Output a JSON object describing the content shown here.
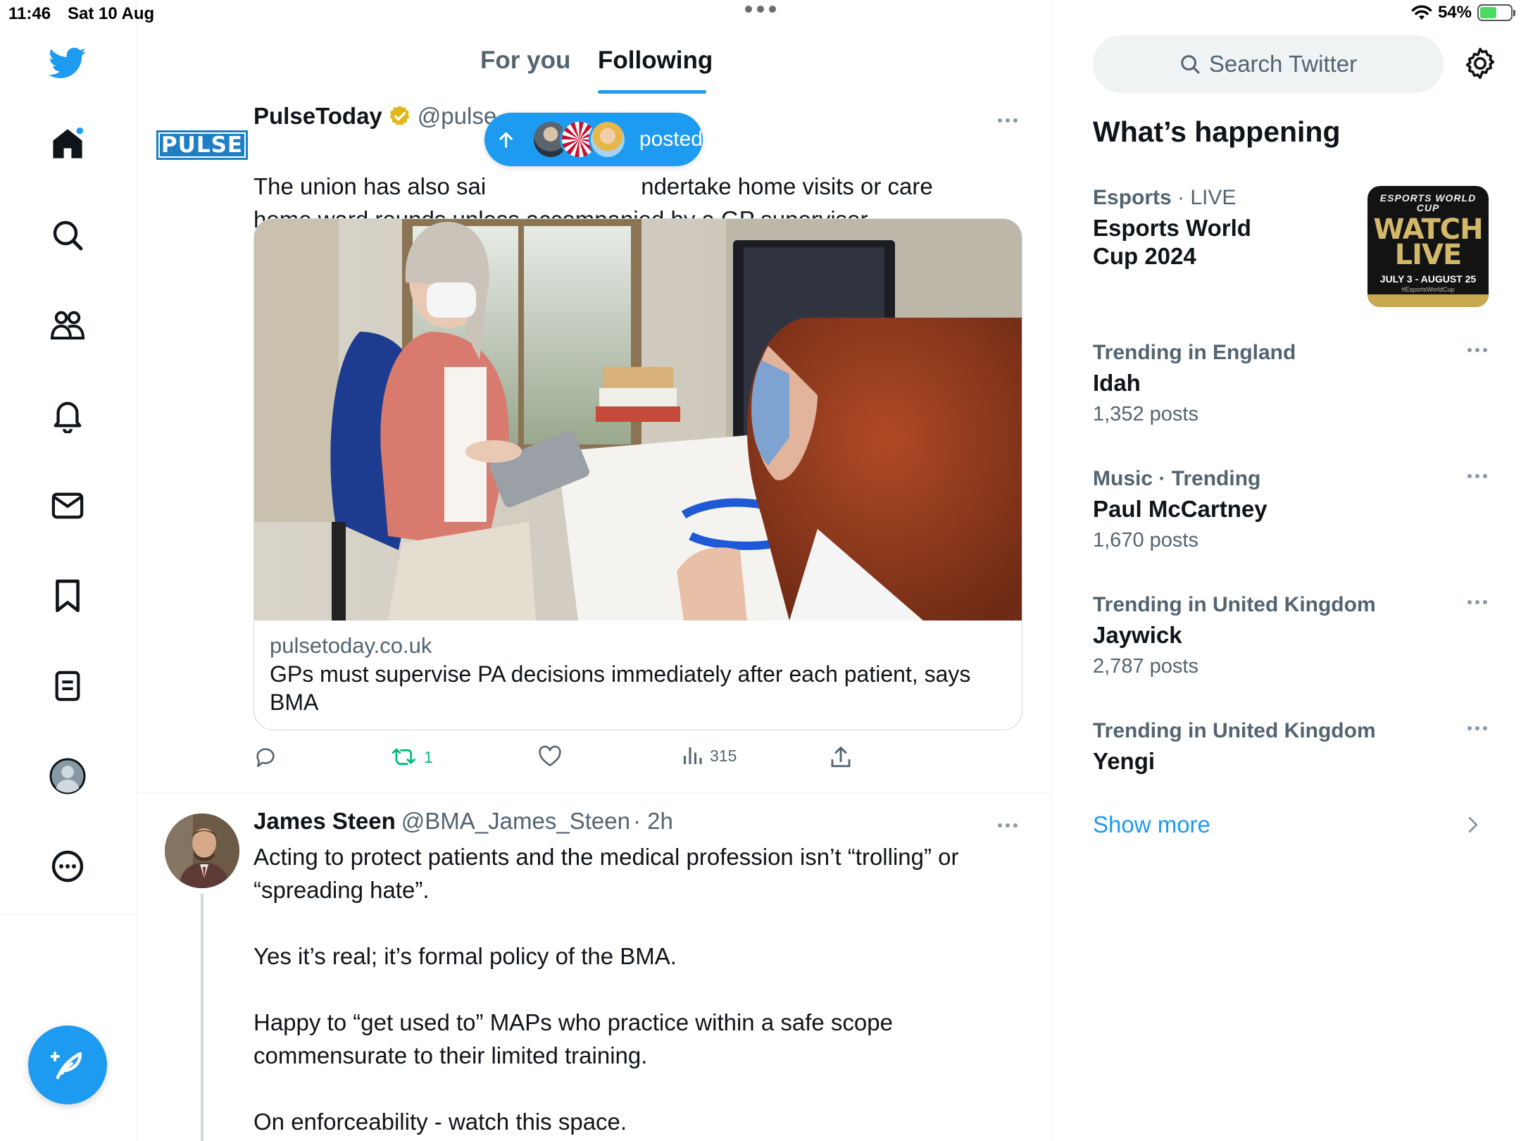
{
  "status_bar": {
    "time": "11:46",
    "date": "Sat 10 Aug",
    "battery": "54%",
    "battery_level": 0.54
  },
  "tabs": [
    {
      "label": "For you"
    },
    {
      "label": "Following"
    }
  ],
  "new_posts_pill": {
    "label": "posted"
  },
  "tweets": [
    {
      "name": "PulseToday",
      "handle": "@pulse",
      "avatar_text": "PULSE",
      "text": "The union has also sai",
      "text_after_pill": "ndertake home visits or care",
      "text_line2": "home ward rounds unless accompanied by a GP supervisor.",
      "card": {
        "domain": "pulsetoday.co.uk",
        "title": "GPs must supervise PA decisions immediately after each patient, says BMA"
      },
      "actions": {
        "reposts": "1",
        "views": "315"
      }
    },
    {
      "name": "James Steen",
      "handle": "@BMA_James_Steen",
      "time": "· 2h",
      "text": "Acting to protect patients and the medical profession isn’t “trolling” or\n“spreading hate”.\n\nYes it’s real; it’s formal policy of the BMA.\n\nHappy to “get used to” MAPs who practice within a safe scope\ncommensurate to their limited training.\n\nOn enforceability - watch this space."
    }
  ],
  "search": {
    "placeholder": "Search Twitter"
  },
  "whats_happening": {
    "title": "What’s happening",
    "trends": [
      {
        "category": "Esports",
        "context": " · LIVE",
        "name": "Esports World Cup 2024",
        "count": ""
      },
      {
        "category": "Trending in England",
        "context": "",
        "name": "Idah",
        "count": "1,352 posts"
      },
      {
        "category": "Music · Trending",
        "context": "",
        "name": "Paul McCartney",
        "count": "1,670 posts"
      },
      {
        "category": "Trending in United Kingdom",
        "context": "",
        "name": "Jaywick",
        "count": "2,787 posts"
      },
      {
        "category": "Trending in United Kingdom",
        "context": "",
        "name": "Yengi",
        "count": ""
      }
    ],
    "esports_thumb": {
      "top": "ESPORTS WORLD CUP",
      "big": "WATCH LIVE",
      "dates": "JULY 3 - AUGUST 25",
      "tag": "#EsportsWorldCup"
    },
    "show_more": "Show more"
  },
  "colors": {
    "accent": "#1d9bf0",
    "repost_green": "#00ba7c",
    "text_secondary": "#536471"
  }
}
